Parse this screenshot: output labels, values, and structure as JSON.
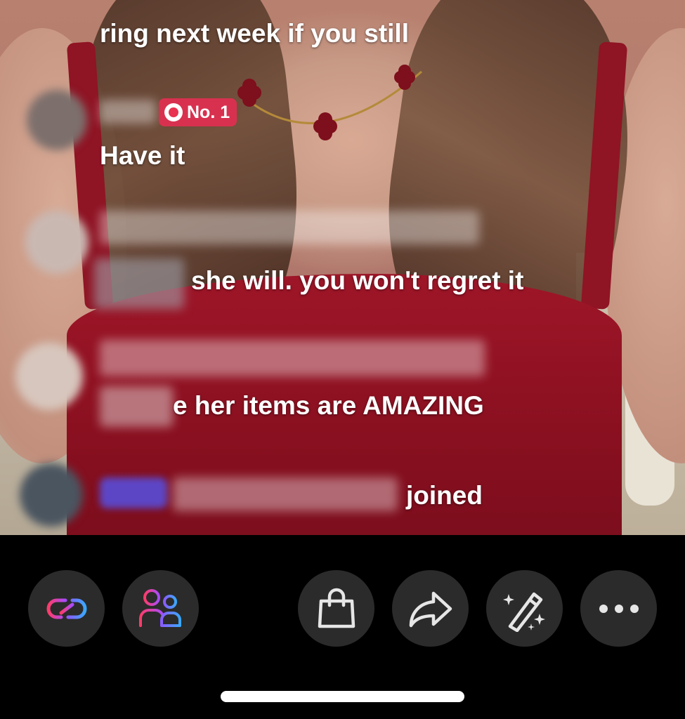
{
  "comments": [
    {
      "text": "ring next week if you still",
      "blurred_name": true
    },
    {
      "badge": "No. 1",
      "text": "Have it",
      "blurred_name": true
    },
    {
      "text": "she will. you won't regret it",
      "blurred_name": true
    },
    {
      "text": "e her items are AMAZING",
      "blurred_name": true
    },
    {
      "text": "joined",
      "blurred_name": true
    }
  ],
  "toolbar": {
    "icons": [
      "collab-link-icon",
      "guests-icon",
      "shopping-bag-icon",
      "share-arrow-icon",
      "magic-wand-icon",
      "more-icon"
    ]
  },
  "colors": {
    "bar_background": "#000000",
    "button_background": "#2b2b2b",
    "badge_red": "#d8314f",
    "accent_pink": "#ff3b6b",
    "accent_blue": "#4a8cff"
  }
}
